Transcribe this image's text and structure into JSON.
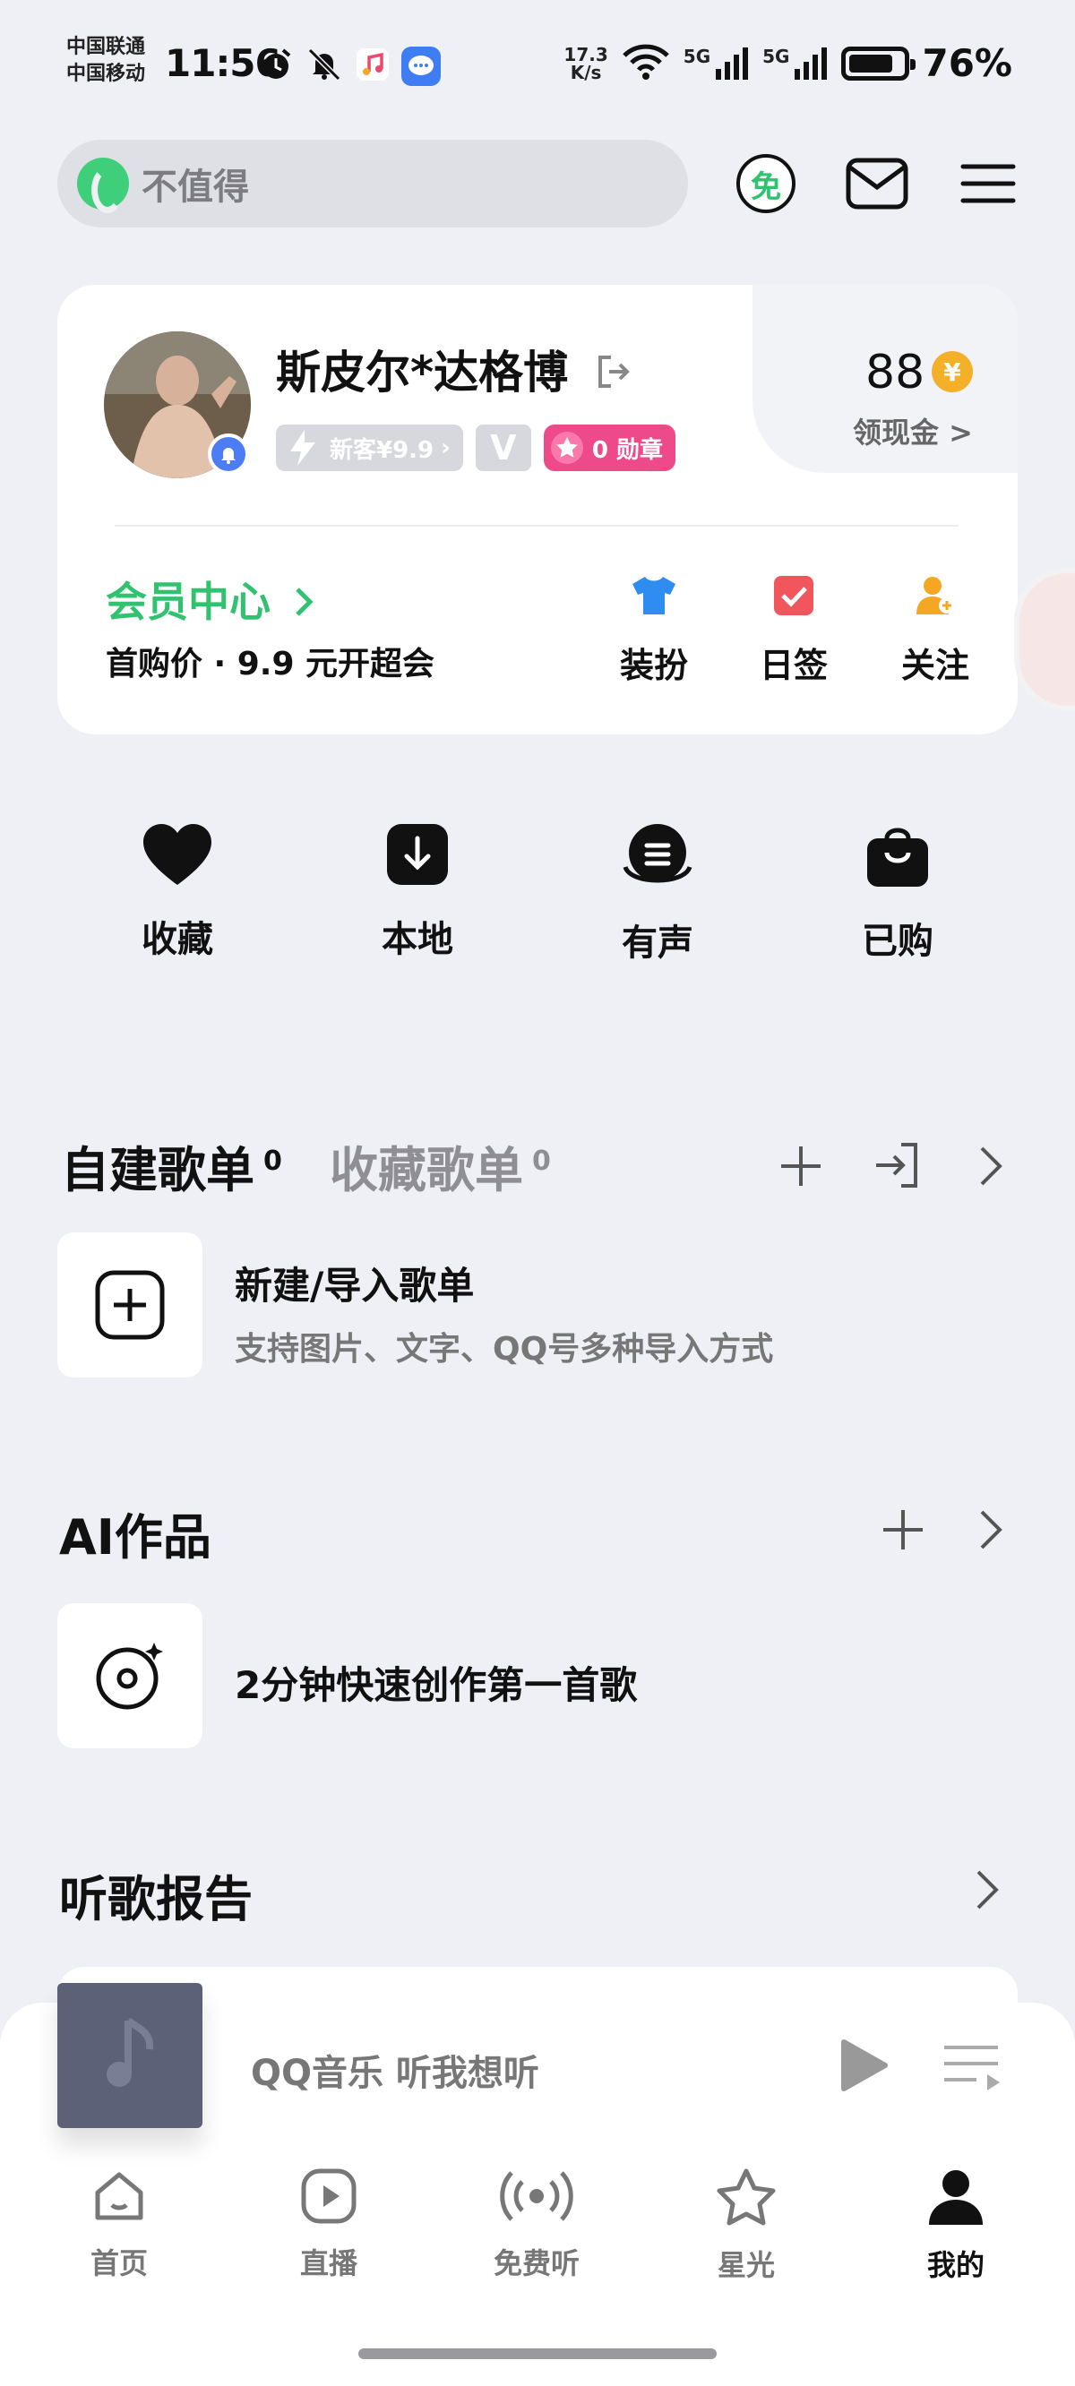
{
  "status_bar": {
    "carrier1": "中国联通",
    "carrier2": "中国移动",
    "time": "11:56",
    "net_speed_value": "17.3",
    "net_speed_unit": "K/s",
    "signal1": "5G",
    "signal2": "5G",
    "battery": "76%"
  },
  "search": {
    "placeholder": "不值得"
  },
  "header": {
    "free_badge": "免"
  },
  "profile": {
    "name": "斯皮尔*达格博",
    "badge_new": "新客¥9.9",
    "badge_v": "V",
    "medals": "0 勋章",
    "coins": "88",
    "coin_symbol": "¥",
    "coins_link": "领现金 >",
    "vip_title": "会员中心",
    "vip_sub": "首购价 · 9.9 元开超会",
    "actions": [
      {
        "label": "装扮",
        "icon": "tshirt-icon",
        "color": "#2f8cf0"
      },
      {
        "label": "日签",
        "icon": "checkbox-icon",
        "color": "#f0565c"
      },
      {
        "label": "关注",
        "icon": "follow-user-icon",
        "color": "#f5a623"
      }
    ]
  },
  "quick_actions": [
    {
      "label": "收藏",
      "icon": "heart-icon"
    },
    {
      "label": "本地",
      "icon": "download-icon"
    },
    {
      "label": "有声",
      "icon": "audiobook-icon"
    },
    {
      "label": "已购",
      "icon": "shopping-bag-icon"
    }
  ],
  "playlists": {
    "tab_created": "自建歌单",
    "tab_created_count": "0",
    "tab_collected": "收藏歌单",
    "tab_collected_count": "0",
    "create_title": "新建/导入歌单",
    "create_sub": "支持图片、文字、QQ号多种导入方式"
  },
  "ai": {
    "title": "AI作品",
    "row_title": "2分钟快速创作第一首歌"
  },
  "report": {
    "title": "听歌报告"
  },
  "player": {
    "title": "QQ音乐 听我想听"
  },
  "nav": [
    {
      "label": "首页",
      "icon": "home-icon"
    },
    {
      "label": "直播",
      "icon": "live-play-icon"
    },
    {
      "label": "免费听",
      "icon": "broadcast-icon"
    },
    {
      "label": "星光",
      "icon": "star-icon"
    },
    {
      "label": "我的",
      "icon": "user-icon",
      "active": true
    }
  ]
}
